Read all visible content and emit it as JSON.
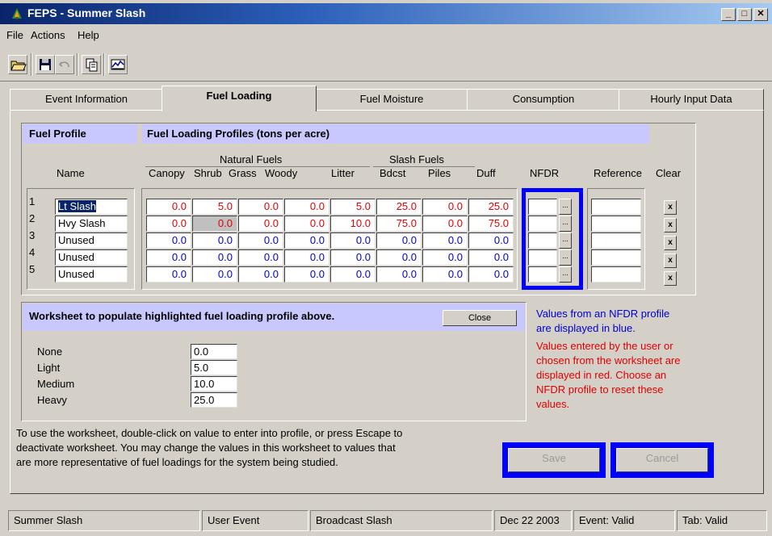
{
  "window": {
    "title": "FEPS - Summer Slash"
  },
  "menu": [
    "File",
    "Actions",
    "Help"
  ],
  "toolbar": [
    "open-icon",
    "save-icon",
    "undo-icon",
    "copy-icon",
    "chart-icon"
  ],
  "tabs": [
    "Event Information",
    "Fuel Loading",
    "Fuel Moisture",
    "Consumption",
    "Hourly Input Data"
  ],
  "active_tab": "Fuel Loading",
  "profile": {
    "fuel_profile_label": "Fuel Profile",
    "loading_title": "Fuel Loading Profiles (tons per acre)",
    "name_header": "Name",
    "natural_fuels_label": "Natural Fuels",
    "slash_fuels_label": "Slash Fuels",
    "columns": [
      "Canopy",
      "Shrub",
      "Grass",
      "Woody",
      "Litter",
      "Bdcst",
      "Piles",
      "Duff"
    ],
    "nfdr_header": "NFDR",
    "reference_header": "Reference",
    "clear_header": "Clear",
    "clear_symbol": "x",
    "nfdr_button": "...",
    "rows": [
      {
        "num": "1",
        "name": "Lt Slash",
        "values": [
          "0.0",
          "5.0",
          "0.0",
          "0.0",
          "5.0",
          "25.0",
          "0.0",
          "25.0"
        ]
      },
      {
        "num": "2",
        "name": "Hvy Slash",
        "values": [
          "0.0",
          "0.0",
          "0.0",
          "0.0",
          "10.0",
          "75.0",
          "0.0",
          "75.0"
        ]
      },
      {
        "num": "3",
        "name": "Unused",
        "values": [
          "0.0",
          "0.0",
          "0.0",
          "0.0",
          "0.0",
          "0.0",
          "0.0",
          "0.0"
        ]
      },
      {
        "num": "4",
        "name": "Unused",
        "values": [
          "0.0",
          "0.0",
          "0.0",
          "0.0",
          "0.0",
          "0.0",
          "0.0",
          "0.0"
        ]
      },
      {
        "num": "5",
        "name": "Unused",
        "values": [
          "0.0",
          "0.0",
          "0.0",
          "0.0",
          "0.0",
          "0.0",
          "0.0",
          "0.0"
        ]
      }
    ]
  },
  "worksheet": {
    "title": "Worksheet to populate highlighted fuel loading profile above.",
    "close_label": "Close",
    "items": [
      {
        "label": "None",
        "value": "0.0"
      },
      {
        "label": "Light",
        "value": "5.0"
      },
      {
        "label": "Medium",
        "value": "10.0"
      },
      {
        "label": "Heavy",
        "value": "25.0"
      }
    ],
    "help_line1": "To use the worksheet, double-click on value to enter into profile, or press Escape to",
    "help_line2": "deactivate worksheet. You may change the values in this worksheet to values that",
    "help_line3": "are more representative of fuel loadings for the system being studied."
  },
  "notes": {
    "blue_line1": "Values from an NFDR profile",
    "blue_line2": "are displayed in blue.",
    "red_line1": "Values entered by the user or",
    "red_line2": "chosen from the worksheet are",
    "red_line3": "displayed in red.  Choose  an",
    "red_line4": "NFDR profile to reset these",
    "red_line5": "values."
  },
  "buttons": {
    "save": "Save",
    "cancel": "Cancel"
  },
  "status": [
    "Summer Slash",
    "User Event",
    "Broadcast Slash",
    "Dec 22 2003",
    "Event: Valid",
    "Tab: Valid"
  ],
  "colors": {
    "user_value": "#e00000",
    "nfdr_value": "#0000d0",
    "highlight": "#0000ff",
    "header_band": "#c8c8ff"
  }
}
